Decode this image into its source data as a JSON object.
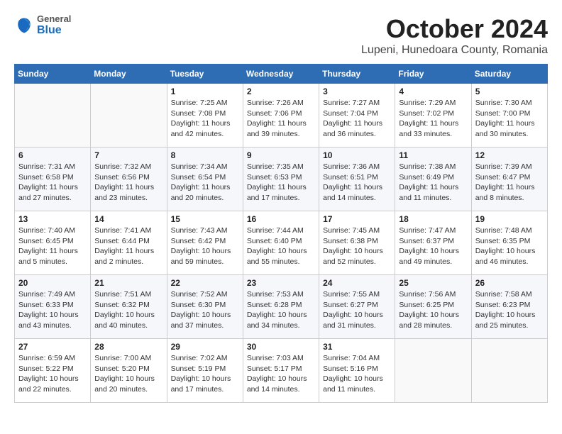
{
  "logo": {
    "general": "General",
    "blue": "Blue"
  },
  "title": "October 2024",
  "location": "Lupeni, Hunedoara County, Romania",
  "days_of_week": [
    "Sunday",
    "Monday",
    "Tuesday",
    "Wednesday",
    "Thursday",
    "Friday",
    "Saturday"
  ],
  "weeks": [
    [
      {
        "day": "",
        "info": ""
      },
      {
        "day": "",
        "info": ""
      },
      {
        "day": "1",
        "info": "Sunrise: 7:25 AM\nSunset: 7:08 PM\nDaylight: 11 hours and 42 minutes."
      },
      {
        "day": "2",
        "info": "Sunrise: 7:26 AM\nSunset: 7:06 PM\nDaylight: 11 hours and 39 minutes."
      },
      {
        "day": "3",
        "info": "Sunrise: 7:27 AM\nSunset: 7:04 PM\nDaylight: 11 hours and 36 minutes."
      },
      {
        "day": "4",
        "info": "Sunrise: 7:29 AM\nSunset: 7:02 PM\nDaylight: 11 hours and 33 minutes."
      },
      {
        "day": "5",
        "info": "Sunrise: 7:30 AM\nSunset: 7:00 PM\nDaylight: 11 hours and 30 minutes."
      }
    ],
    [
      {
        "day": "6",
        "info": "Sunrise: 7:31 AM\nSunset: 6:58 PM\nDaylight: 11 hours and 27 minutes."
      },
      {
        "day": "7",
        "info": "Sunrise: 7:32 AM\nSunset: 6:56 PM\nDaylight: 11 hours and 23 minutes."
      },
      {
        "day": "8",
        "info": "Sunrise: 7:34 AM\nSunset: 6:54 PM\nDaylight: 11 hours and 20 minutes."
      },
      {
        "day": "9",
        "info": "Sunrise: 7:35 AM\nSunset: 6:53 PM\nDaylight: 11 hours and 17 minutes."
      },
      {
        "day": "10",
        "info": "Sunrise: 7:36 AM\nSunset: 6:51 PM\nDaylight: 11 hours and 14 minutes."
      },
      {
        "day": "11",
        "info": "Sunrise: 7:38 AM\nSunset: 6:49 PM\nDaylight: 11 hours and 11 minutes."
      },
      {
        "day": "12",
        "info": "Sunrise: 7:39 AM\nSunset: 6:47 PM\nDaylight: 11 hours and 8 minutes."
      }
    ],
    [
      {
        "day": "13",
        "info": "Sunrise: 7:40 AM\nSunset: 6:45 PM\nDaylight: 11 hours and 5 minutes."
      },
      {
        "day": "14",
        "info": "Sunrise: 7:41 AM\nSunset: 6:44 PM\nDaylight: 11 hours and 2 minutes."
      },
      {
        "day": "15",
        "info": "Sunrise: 7:43 AM\nSunset: 6:42 PM\nDaylight: 10 hours and 59 minutes."
      },
      {
        "day": "16",
        "info": "Sunrise: 7:44 AM\nSunset: 6:40 PM\nDaylight: 10 hours and 55 minutes."
      },
      {
        "day": "17",
        "info": "Sunrise: 7:45 AM\nSunset: 6:38 PM\nDaylight: 10 hours and 52 minutes."
      },
      {
        "day": "18",
        "info": "Sunrise: 7:47 AM\nSunset: 6:37 PM\nDaylight: 10 hours and 49 minutes."
      },
      {
        "day": "19",
        "info": "Sunrise: 7:48 AM\nSunset: 6:35 PM\nDaylight: 10 hours and 46 minutes."
      }
    ],
    [
      {
        "day": "20",
        "info": "Sunrise: 7:49 AM\nSunset: 6:33 PM\nDaylight: 10 hours and 43 minutes."
      },
      {
        "day": "21",
        "info": "Sunrise: 7:51 AM\nSunset: 6:32 PM\nDaylight: 10 hours and 40 minutes."
      },
      {
        "day": "22",
        "info": "Sunrise: 7:52 AM\nSunset: 6:30 PM\nDaylight: 10 hours and 37 minutes."
      },
      {
        "day": "23",
        "info": "Sunrise: 7:53 AM\nSunset: 6:28 PM\nDaylight: 10 hours and 34 minutes."
      },
      {
        "day": "24",
        "info": "Sunrise: 7:55 AM\nSunset: 6:27 PM\nDaylight: 10 hours and 31 minutes."
      },
      {
        "day": "25",
        "info": "Sunrise: 7:56 AM\nSunset: 6:25 PM\nDaylight: 10 hours and 28 minutes."
      },
      {
        "day": "26",
        "info": "Sunrise: 7:58 AM\nSunset: 6:23 PM\nDaylight: 10 hours and 25 minutes."
      }
    ],
    [
      {
        "day": "27",
        "info": "Sunrise: 6:59 AM\nSunset: 5:22 PM\nDaylight: 10 hours and 22 minutes."
      },
      {
        "day": "28",
        "info": "Sunrise: 7:00 AM\nSunset: 5:20 PM\nDaylight: 10 hours and 20 minutes."
      },
      {
        "day": "29",
        "info": "Sunrise: 7:02 AM\nSunset: 5:19 PM\nDaylight: 10 hours and 17 minutes."
      },
      {
        "day": "30",
        "info": "Sunrise: 7:03 AM\nSunset: 5:17 PM\nDaylight: 10 hours and 14 minutes."
      },
      {
        "day": "31",
        "info": "Sunrise: 7:04 AM\nSunset: 5:16 PM\nDaylight: 10 hours and 11 minutes."
      },
      {
        "day": "",
        "info": ""
      },
      {
        "day": "",
        "info": ""
      }
    ]
  ]
}
